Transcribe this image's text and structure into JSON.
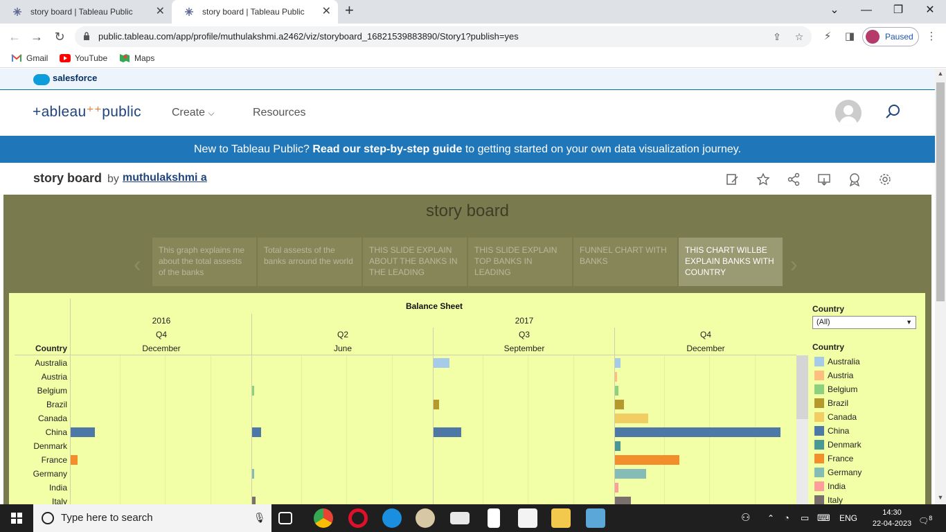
{
  "browser": {
    "tabs": [
      {
        "title": "story board | Tableau Public"
      },
      {
        "title": "story board | Tableau Public"
      }
    ],
    "url": "public.tableau.com/app/profile/muthulakshmi.a2462/viz/storyboard_16821539883890/Story1?publish=yes",
    "profile_status": "Paused",
    "bookmarks": [
      "Gmail",
      "YouTube",
      "Maps"
    ]
  },
  "site": {
    "brand": "salesforce",
    "logo_text": "+ableau",
    "logo_suffix": "public",
    "nav": {
      "create": "Create",
      "resources": "Resources"
    },
    "banner_prefix": "New to Tableau Public?",
    "banner_link": "Read our step-by-step guide",
    "banner_suffix": "to getting started on your own data visualization journey."
  },
  "viz": {
    "title": "story board",
    "by": "by",
    "author": "muthulakshmi a"
  },
  "story": {
    "title": "story board",
    "points": [
      "This graph explains me about the total assests of the banks",
      "Total assests of the banks arround the world",
      "THIS SLIDE EXPLAIN ABOUT THE BANKS IN THE LEADING",
      "THIS SLIDE EXPLAIN TOP BANKS IN LEADING",
      "FUNNEL CHART WITH BANKS",
      "THIS CHART WILLBE EXPLAIN BANKS WITH COUNTRY"
    ],
    "active_index": 5
  },
  "sheet": {
    "title": "Balance Sheet",
    "row_header": "Country",
    "years": [
      "2016",
      "2017"
    ],
    "columns": [
      {
        "quarter": "Q4",
        "month": "December"
      },
      {
        "quarter": "Q2",
        "month": "June"
      },
      {
        "quarter": "Q3",
        "month": "September"
      },
      {
        "quarter": "Q4",
        "month": "December"
      }
    ]
  },
  "chart_data": {
    "type": "bar",
    "title": "Balance Sheet",
    "orientation": "horizontal",
    "categories": [
      "Australia",
      "Austria",
      "Belgium",
      "Brazil",
      "Canada",
      "China",
      "Denmark",
      "France",
      "Germany",
      "India",
      "Italy"
    ],
    "panels": [
      "2016 Q4 December",
      "2017 Q2 June",
      "2017 Q3 September",
      "2017 Q4 December"
    ],
    "panel_max": 1.0,
    "values": [
      [
        0,
        0,
        0,
        0,
        0,
        0.14,
        0,
        0.04,
        0,
        0,
        0
      ],
      [
        0,
        0,
        0.01,
        0,
        0,
        0.05,
        0,
        0,
        0.01,
        0,
        0.02
      ],
      [
        0.09,
        0,
        0,
        0.03,
        0,
        0.16,
        0,
        0,
        0,
        0,
        0
      ],
      [
        0.03,
        0.01,
        0.02,
        0.05,
        0.19,
        0.95,
        0.03,
        0.37,
        0.18,
        0.02,
        0.09
      ]
    ],
    "colors": [
      "#a6cbe8",
      "#ffbe7d",
      "#8cd17d",
      "#b6992d",
      "#f1ce63",
      "#4e79a7",
      "#499894",
      "#f28e2b",
      "#86bcb6",
      "#ff9d9a",
      "#79706e"
    ]
  },
  "legend": {
    "filter_title": "Country",
    "filter_value": "(All)",
    "title": "Country",
    "items": [
      "Australia",
      "Austria",
      "Belgium",
      "Brazil",
      "Canada",
      "China",
      "Denmark",
      "France",
      "Germany",
      "India",
      "Italy"
    ]
  },
  "taskbar": {
    "search_placeholder": "Type here to search",
    "lang": "ENG",
    "time": "14:30",
    "date": "22-04-2023",
    "notifications": "8"
  }
}
